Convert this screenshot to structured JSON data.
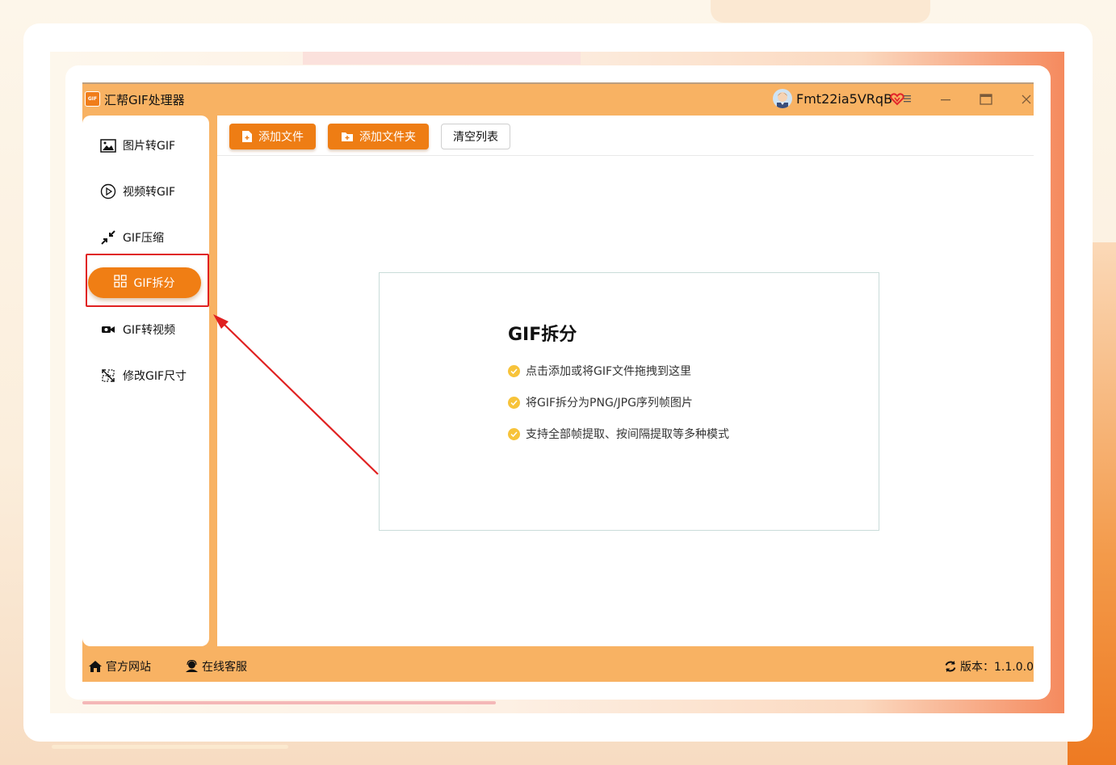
{
  "app": {
    "title": "汇帮GIF处理器",
    "logo_text": "GIF",
    "user_name": "Fmt22ia5VRqB"
  },
  "sidebar": {
    "items": [
      {
        "label": "图片转GIF",
        "icon": "image-icon"
      },
      {
        "label": "视频转GIF",
        "icon": "play-icon"
      },
      {
        "label": "GIF压缩",
        "icon": "compress-icon"
      },
      {
        "label": "GIF拆分",
        "icon": "grid-icon",
        "active": true
      },
      {
        "label": "GIF转视频",
        "icon": "video-camera-icon"
      },
      {
        "label": "修改GIF尺寸",
        "icon": "resize-icon"
      }
    ]
  },
  "toolbar": {
    "add_file": "添加文件",
    "add_folder": "添加文件夹",
    "clear_list": "清空列表"
  },
  "dropzone": {
    "title": "GIF拆分",
    "lines": [
      "点击添加或将GIF文件拖拽到这里",
      "将GIF拆分为PNG/JPG序列帧图片",
      "支持全部帧提取、按间隔提取等多种模式"
    ]
  },
  "statusbar": {
    "website": "官方网站",
    "service": "在线客服",
    "version": "版本：1.1.0.0"
  },
  "colors": {
    "accent": "#f07e14",
    "frame": "#f8b263",
    "highlight": "#e02020",
    "check": "#f7c33a"
  }
}
